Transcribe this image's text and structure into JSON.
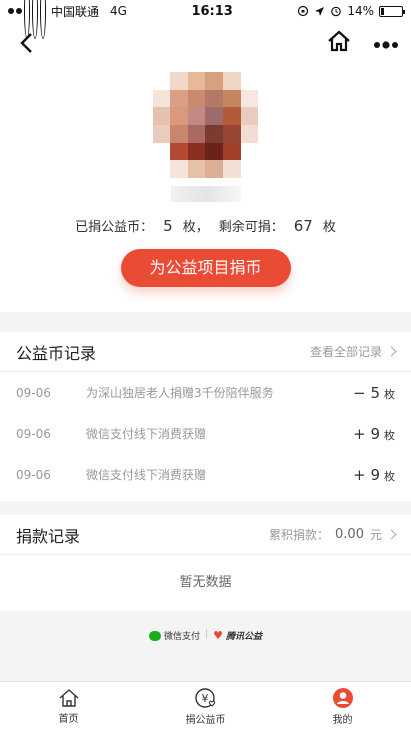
{
  "status": {
    "carrier": "中国联通",
    "network": "4G",
    "time": "16:13",
    "battery": "14%",
    "battery_level": 0.14
  },
  "header": {
    "back_icon": "chevron-left-icon",
    "home_icon": "home-icon",
    "more_icon": "more-dots-icon"
  },
  "profile": {
    "donated_label": "已捐公益币：",
    "donated_value": "5",
    "donated_unit": "枚，",
    "remain_label": "剩余可捐：",
    "remain_value": "67",
    "remain_unit": "枚",
    "donate_button": "为公益项目捐币"
  },
  "coin_records": {
    "title": "公益币记录",
    "view_all": "查看全部记录",
    "items": [
      {
        "date": "09-06",
        "desc": "为深山独居老人捐赠3千份陪伴服务",
        "amount": "− 5",
        "unit": "枚"
      },
      {
        "date": "09-06",
        "desc": "微信支付线下消费获赠",
        "amount": "+ 9",
        "unit": "枚"
      },
      {
        "date": "09-06",
        "desc": "微信支付线下消费获赠",
        "amount": "+ 9",
        "unit": "枚"
      }
    ]
  },
  "donation_records": {
    "title": "捐款记录",
    "total_label": "累积捐款：",
    "total_value": "0.00",
    "total_unit": "元",
    "empty_text": "暂无数据"
  },
  "footer": {
    "wechat_pay": "微信支付",
    "tencent_charity": "腾讯公益"
  },
  "tabs": [
    {
      "label": "首页",
      "icon": "home-icon"
    },
    {
      "label": "捐公益币",
      "icon": "yen-coin-icon"
    },
    {
      "label": "我的",
      "icon": "user-icon"
    }
  ]
}
